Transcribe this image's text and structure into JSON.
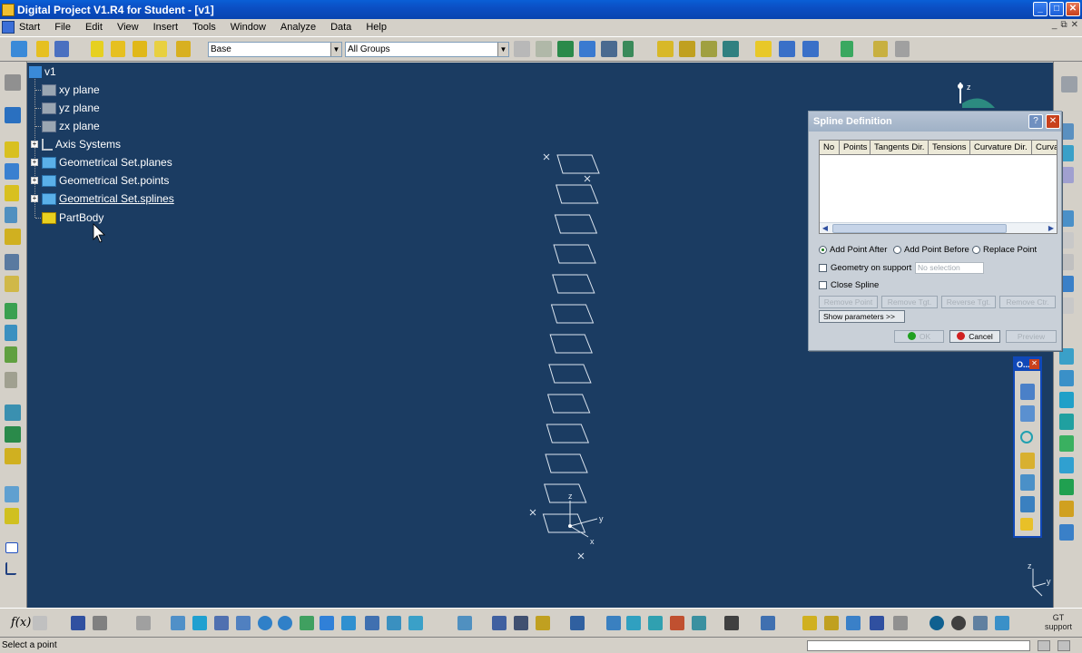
{
  "window": {
    "title": "Digital Project V1.R4 for Student - [v1]",
    "buttons": {
      "minimize": "_",
      "maximize": "□",
      "close": "✕"
    }
  },
  "menu": {
    "items": [
      "Start",
      "File",
      "Edit",
      "View",
      "Insert",
      "Tools",
      "Window",
      "Analyze",
      "Data",
      "Help"
    ],
    "doc_buttons": [
      "_",
      "⧉",
      "✕"
    ]
  },
  "toolbar": {
    "layer_combo": "Base",
    "group_combo": "All Groups"
  },
  "tree": {
    "root": "v1",
    "nodes": [
      "xy plane",
      "yz plane",
      "zx plane",
      "Axis Systems",
      "Geometrical Set.planes",
      "Geometrical Set.points",
      "Geometrical Set.splines",
      "PartBody"
    ]
  },
  "viewport": {
    "background": "#1b3c62",
    "axis_labels": {
      "x": "x",
      "y": "y",
      "z": "z"
    }
  },
  "dialog": {
    "title": "Spline Definition",
    "help_btn": "?",
    "close_btn": "✕",
    "columns": [
      "No",
      "Points",
      "Tangents Dir.",
      "Tensions",
      "Curvature Dir.",
      "Curva"
    ],
    "radio_after": "Add Point After",
    "radio_before": "Add Point Before",
    "radio_replace": "Replace Point",
    "selected_radio": "Add Point After",
    "geometry_support": "Geometry on support",
    "geometry_placeholder": "No selection",
    "close_spline": "Close Spline",
    "remove_point": "Remove Point",
    "remove_tgt": "Remove Tgt.",
    "reverse_tgt": "Reverse Tgt.",
    "remove_ctr": "Remove Ctr.",
    "show_params": "Show parameters >>",
    "ok": "OK",
    "cancel": "Cancel",
    "preview": "Preview"
  },
  "floatbar": {
    "title": "O...",
    "close": "✕"
  },
  "bottom": {
    "fx": "f(x)",
    "gt_support": "GT support"
  },
  "status": {
    "message": "Select a point"
  },
  "colors": {
    "titlebar": "#0b4fc4",
    "chrome": "#d4d0c8",
    "viewport": "#1b3c62",
    "dialog": "#c9d0d8"
  }
}
